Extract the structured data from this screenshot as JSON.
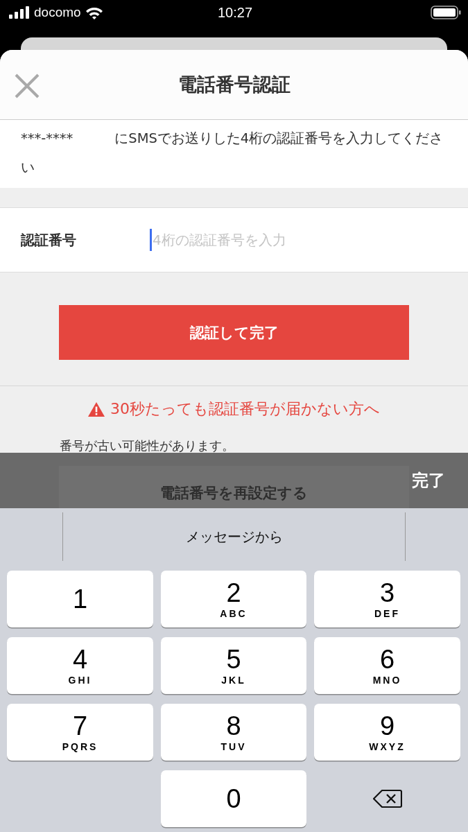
{
  "status_bar": {
    "carrier": "docomo",
    "time": "10:27"
  },
  "header": {
    "title": "電話番号認証"
  },
  "instruction": "***-****　　　にSMSでお送りした4桁の認証番号を入力してください",
  "code_field": {
    "label": "認証番号",
    "placeholder": "4桁の認証番号を入力",
    "focused": true
  },
  "submit_button": "認証して完了",
  "help": {
    "heading": "30秒たっても認証番号が届かない方へ",
    "note": "番号が古い可能性があります。",
    "reset_button": "電話番号を再設定する"
  },
  "keyboard": {
    "done": "完了",
    "suggestion": "メッセージから",
    "keys": [
      {
        "kind": "digit",
        "digit": "1"
      },
      {
        "kind": "digit",
        "digit": "2",
        "letters": "ABC"
      },
      {
        "kind": "digit",
        "digit": "3",
        "letters": "DEF"
      },
      {
        "kind": "digit",
        "digit": "4",
        "letters": "GHI"
      },
      {
        "kind": "digit",
        "digit": "5",
        "letters": "JKL"
      },
      {
        "kind": "digit",
        "digit": "6",
        "letters": "MNO"
      },
      {
        "kind": "digit",
        "digit": "7",
        "letters": "PQRS"
      },
      {
        "kind": "digit",
        "digit": "8",
        "letters": "TUV"
      },
      {
        "kind": "digit",
        "digit": "9",
        "letters": "WXYZ"
      },
      {
        "kind": "blank"
      },
      {
        "kind": "digit",
        "digit": "0"
      },
      {
        "kind": "delete"
      }
    ]
  }
}
